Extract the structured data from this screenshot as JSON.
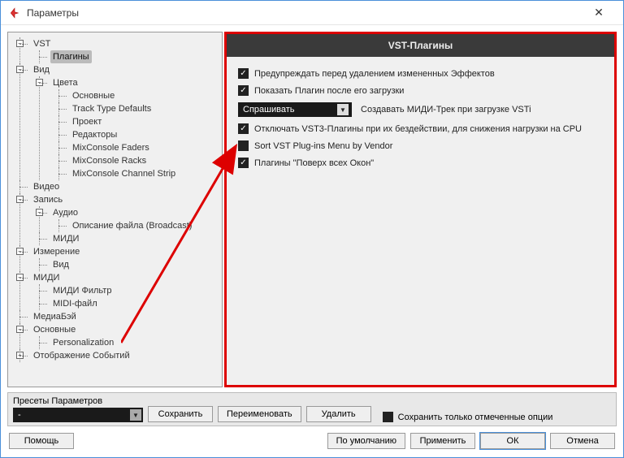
{
  "window": {
    "title": "Параметры"
  },
  "tree": {
    "vst": "VST",
    "plugins": "Плагины",
    "view": "Вид",
    "colors": "Цвета",
    "main": "Основные",
    "trackTypeDefaults": "Track Type Defaults",
    "project": "Проект",
    "editors": "Редакторы",
    "mixFaders": "MixConsole Faders",
    "mixRacks": "MixConsole Racks",
    "mixChannel": "MixConsole Channel Strip",
    "video": "Видео",
    "record": "Запись",
    "audio": "Аудио",
    "broadcast": "Описание файла (Broadcast)",
    "midi": "МИДИ",
    "measurement": "Измерение",
    "measView": "Вид",
    "midi2": "МИДИ",
    "midiFilter": "МИДИ Фильтр",
    "midiFile": "MIDI-файл",
    "mediaBay": "МедиаБэй",
    "main2": "Основные",
    "personalization": "Personalization",
    "eventDisplay": "Отображение Событий"
  },
  "panel": {
    "title": "VST-Плагины",
    "opt1": "Предупреждать перед удалением измененных Эффектов",
    "opt2": "Показать Плагин после его загрузки",
    "askValue": "Спрашивать",
    "opt3label": "Создавать МИДИ-Трек при загрузке VSTi",
    "opt4": "Отключать VST3-Плагины при их бездействии, для снижения нагрузки на CPU",
    "opt5": "Sort VST Plug-ins Menu by Vendor",
    "opt6": "Плагины \"Поверх всех Окон\""
  },
  "presets": {
    "label": "Пресеты Параметров",
    "value": "-",
    "save": "Сохранить",
    "rename": "Переименовать",
    "delete": "Удалить",
    "saveChecked": "Сохранить только отмеченные опции"
  },
  "footer": {
    "help": "Помощь",
    "defaults": "По умолчанию",
    "apply": "Применить",
    "ok": "ОК",
    "cancel": "Отмена"
  }
}
